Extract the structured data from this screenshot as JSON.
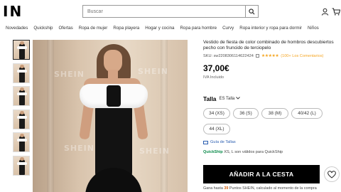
{
  "header": {
    "logo": "IN",
    "search_placeholder": "Buscar"
  },
  "nav": {
    "items": [
      "Novedades",
      "Quickship",
      "Ofertas",
      "Ropa de mujer",
      "Ropa playera",
      "Hogar y cocina",
      "Ropa para hombre",
      "Curvy",
      "Ropa interior y ropa para dormir",
      "Niños"
    ]
  },
  "gallery": {
    "watermark": "SHEIN"
  },
  "product": {
    "title": "Vestido de fiesta de color combinado de hombros descubiertos pecho con fruncido de terciopelo",
    "sku": "SKU: sw2208306114622424",
    "stars": "★★★★★",
    "reviews": "(100+ Los Comentarios)",
    "price": "37,00€",
    "tax_note": "IVA Incluido",
    "size_label": "Talla",
    "size_system": "ES Talla",
    "sizes": [
      "34 (XS)",
      "36 (S)",
      "38 (M)",
      "40/42 (L)",
      "44 (XL)"
    ],
    "size_guide": "Guía de Tallas",
    "quickship_brand": "QuickShip",
    "quickship_text": "XS, L son válidos para QuickShip",
    "add_to_cart": "AÑADIR A LA CESTA",
    "points_prefix": "Gana hasta",
    "points_value": "39",
    "points_suffix": "Puntos SHEIN, calculado al momento de la compra"
  },
  "colors": {
    "accent_star": "#f5a623",
    "quickship_green": "#0a8a4a",
    "link_blue": "#2a5db0",
    "cta_black": "#000000"
  }
}
